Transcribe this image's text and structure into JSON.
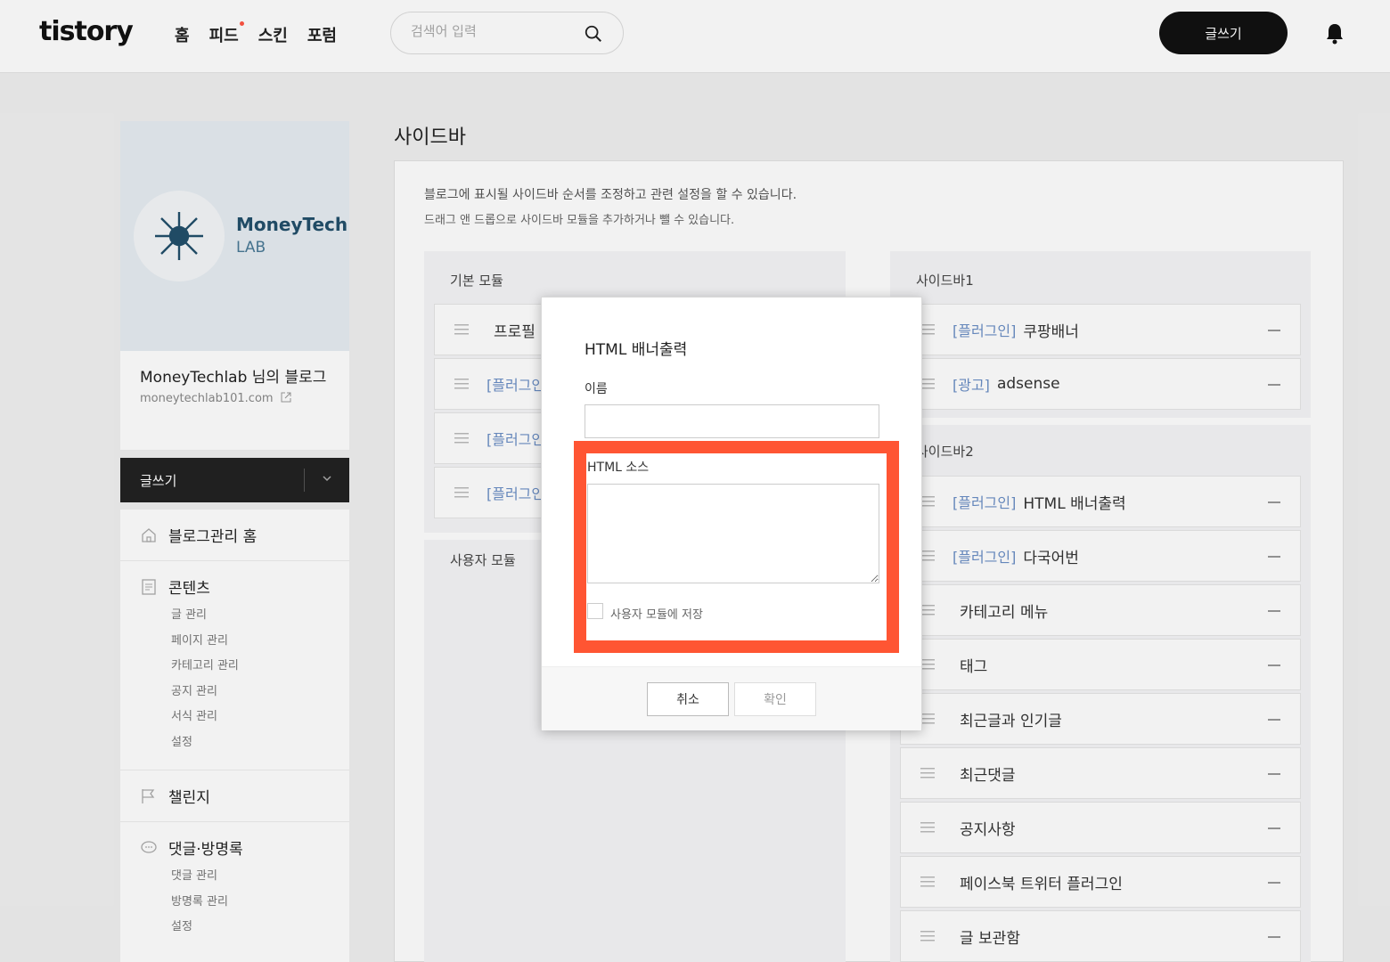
{
  "header": {
    "logo": "tistory",
    "nav": [
      "홈",
      "피드",
      "스킨",
      "포럼"
    ],
    "search_placeholder": "검색어 입력",
    "write_label": "글쓰기"
  },
  "profile": {
    "brand_name": "MoneyTech",
    "brand_sub": "LAB",
    "blog_name": "MoneyTechlab 님의 블로그",
    "blog_url": "moneytechlab101.com",
    "write_label": "글쓰기"
  },
  "menu": {
    "home": "블로그관리 홈",
    "contents": {
      "label": "콘텐츠",
      "items": [
        "글 관리",
        "페이지 관리",
        "카테고리 관리",
        "공지 관리",
        "서식 관리",
        "설정"
      ]
    },
    "challenge": "챌린지",
    "comments": {
      "label": "댓글·방명록",
      "items": [
        "댓글 관리",
        "방명록 관리",
        "설정"
      ]
    }
  },
  "main": {
    "title": "사이드바",
    "desc1": "블로그에 표시될 사이드바 순서를 조정하고 관련 설정을 할 수 있습니다.",
    "desc2": "드래그 앤 드롭으로 사이드바 모듈을 추가하거나 뺄 수 있습니다.",
    "basic_title": "기본 모듈",
    "basic_modules": [
      {
        "tag": "",
        "name": "프로필"
      },
      {
        "tag": "[플러그인",
        "name": ""
      },
      {
        "tag": "[플러그인",
        "name": ""
      },
      {
        "tag": "[플러그인",
        "name": ""
      }
    ],
    "user_title": "사용자 모듈",
    "sidebar1_title": "사이드바1",
    "sidebar1_modules": [
      {
        "tag": "[플러그인]",
        "name": "쿠팡배너"
      },
      {
        "tag": "[광고]",
        "name": "adsense"
      }
    ],
    "sidebar2_title": "사이드바2",
    "sidebar2_modules": [
      {
        "tag": "[플러그인]",
        "name": "HTML 배너출력"
      },
      {
        "tag": "[플러그인]",
        "name": "다국어번"
      },
      {
        "tag": "",
        "name": "카테고리 메뉴"
      },
      {
        "tag": "",
        "name": "태그"
      },
      {
        "tag": "",
        "name": "최근글과 인기글"
      },
      {
        "tag": "",
        "name": "최근댓글"
      },
      {
        "tag": "",
        "name": "공지사항"
      },
      {
        "tag": "",
        "name": "페이스북 트위터 플러그인"
      },
      {
        "tag": "",
        "name": "글 보관함"
      }
    ]
  },
  "dialog": {
    "title": "HTML 배너출력",
    "name_label": "이름",
    "name_value": "",
    "source_label": "HTML 소스",
    "source_value": "",
    "save_label": "사용자 모듈에 저장",
    "cancel_label": "취소",
    "ok_label": "확인"
  },
  "colors": {
    "highlight": "#ff5533",
    "plugin_tag": "#6b8fc6",
    "brand": "#22506b"
  }
}
